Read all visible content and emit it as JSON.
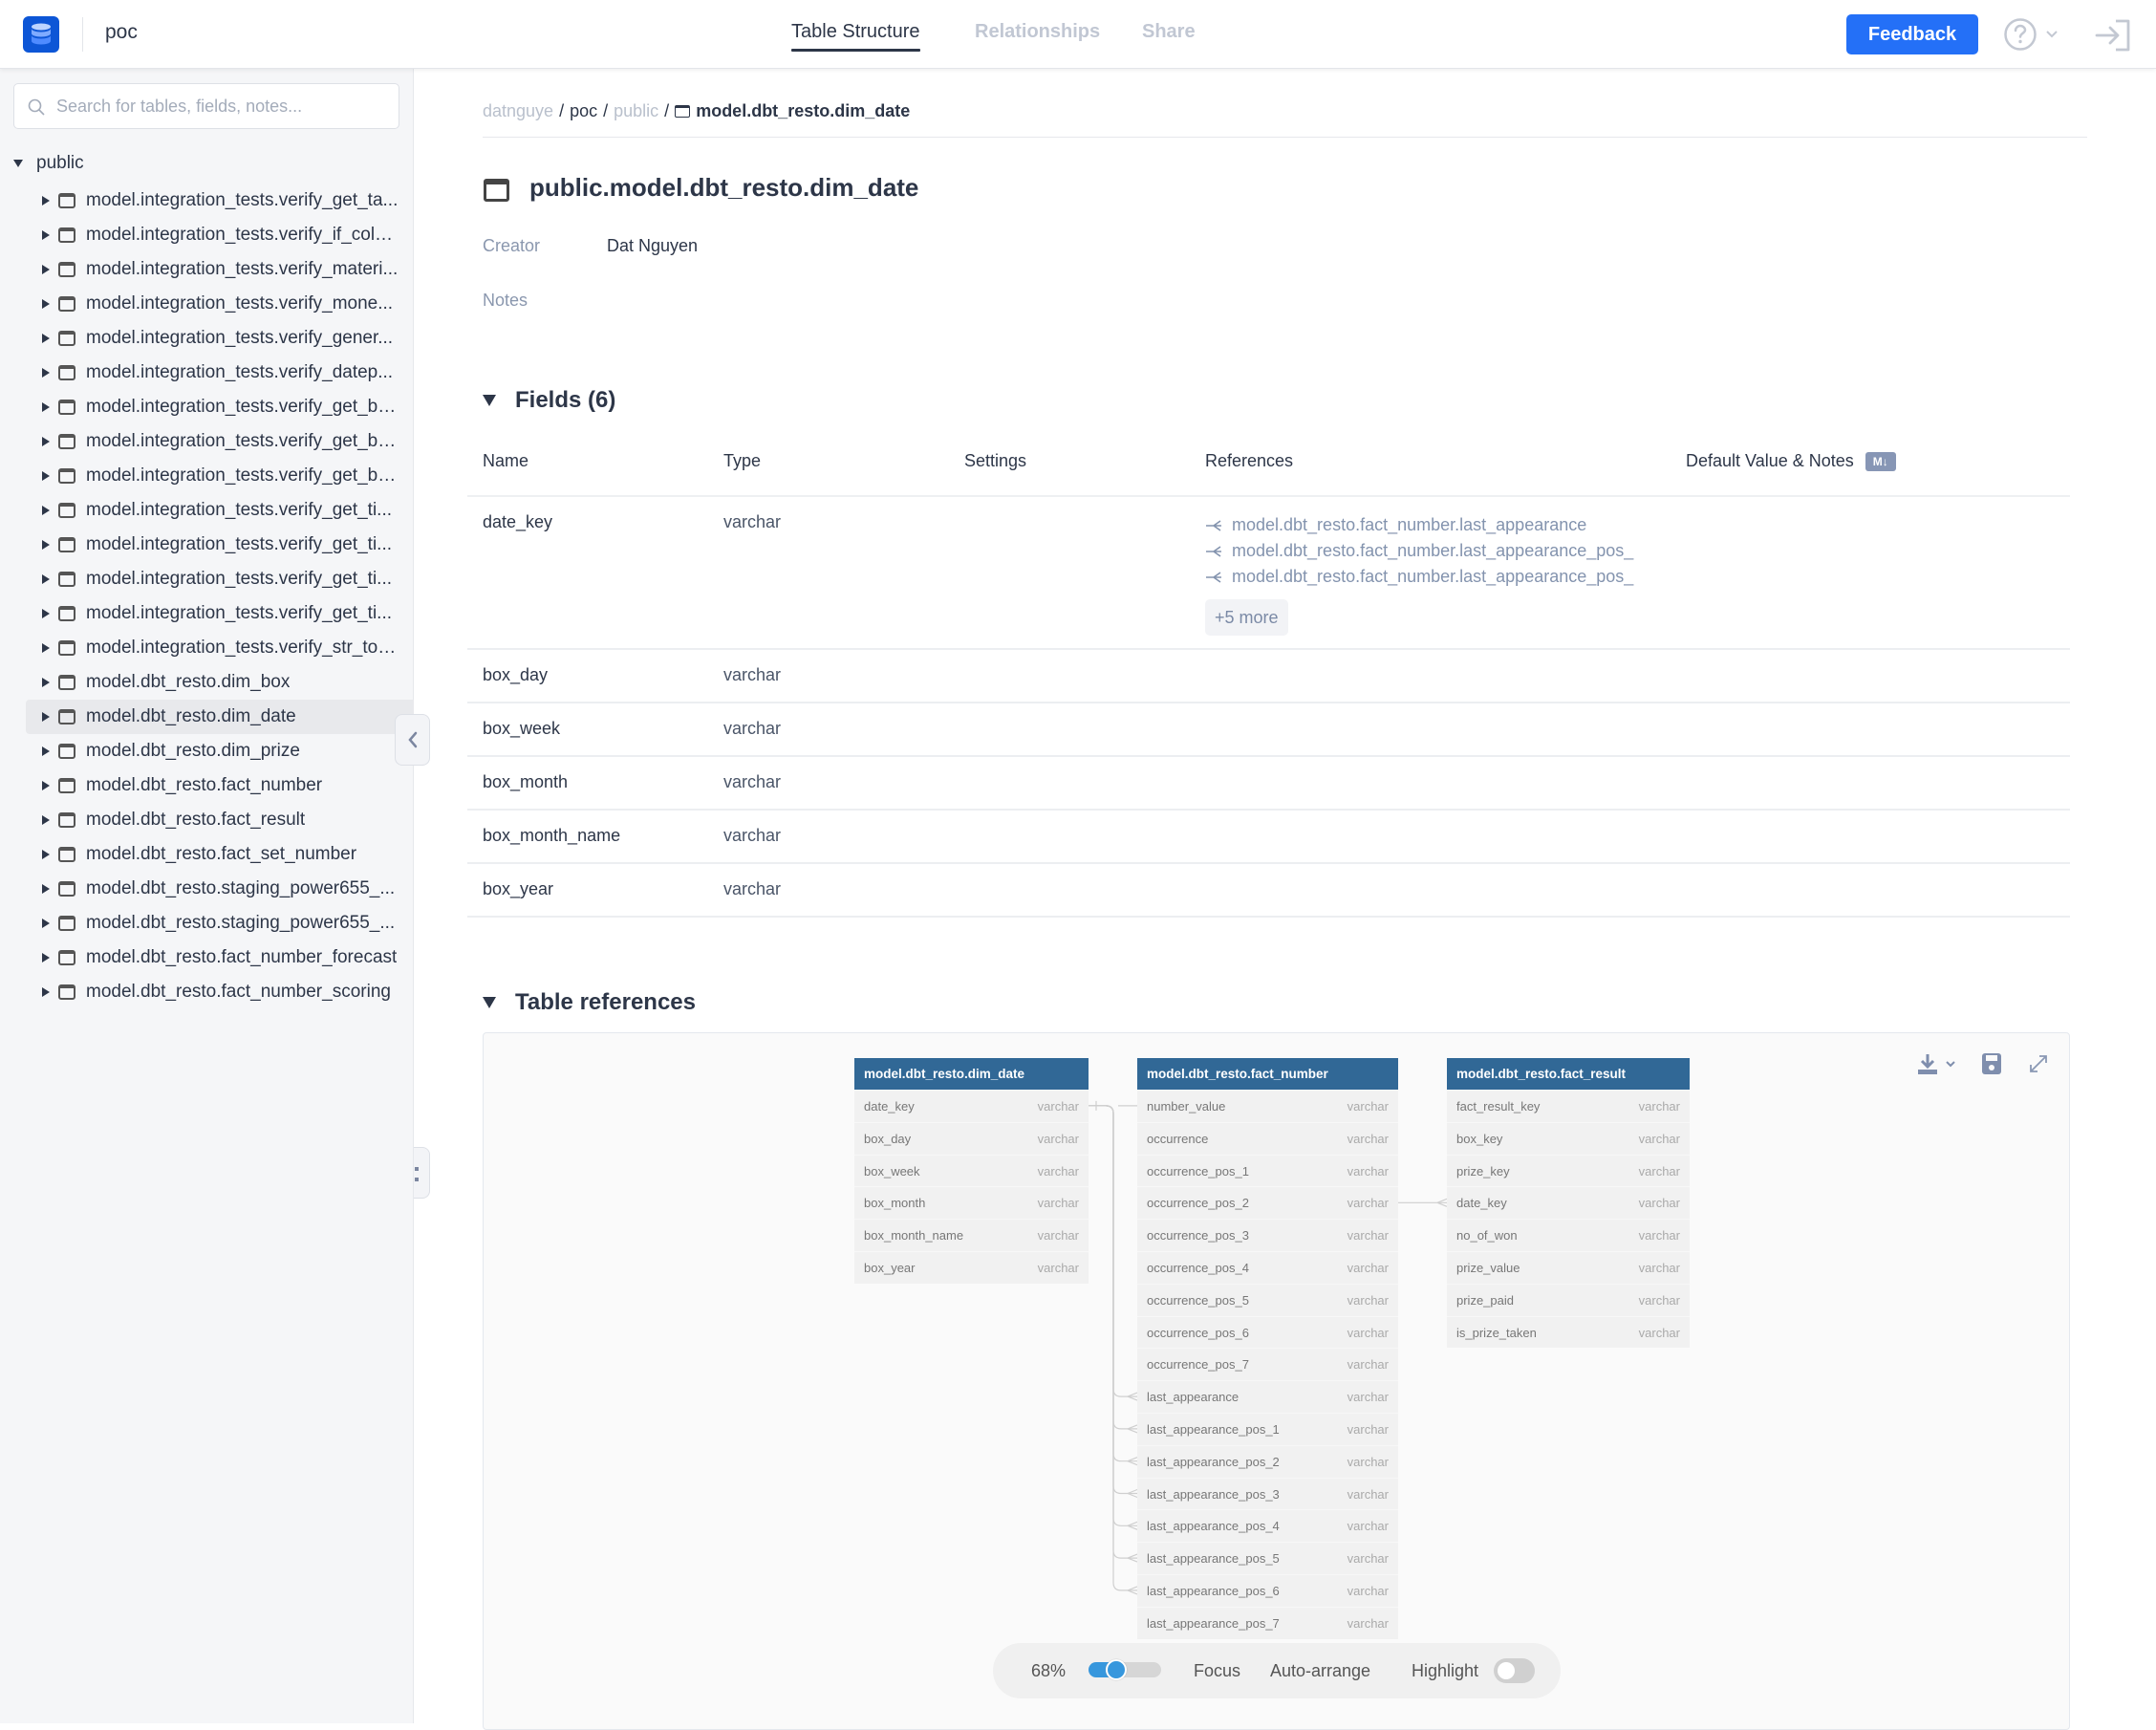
{
  "header": {
    "project_name": "poc",
    "tabs": [
      {
        "label": "Table Structure",
        "active": true
      },
      {
        "label": "Relationships",
        "active": false
      },
      {
        "label": "Share",
        "active": false
      }
    ],
    "feedback_label": "Feedback",
    "accent_color": "#2470f7"
  },
  "sidebar": {
    "search_placeholder": "Search for tables, fields, notes...",
    "search_value": "",
    "schema": "public",
    "selected_index": 15,
    "items": [
      "model.integration_tests.verify_get_ta...",
      "model.integration_tests.verify_if_colu...",
      "model.integration_tests.verify_materi...",
      "model.integration_tests.verify_mone...",
      "model.integration_tests.verify_gener...",
      "model.integration_tests.verify_datep...",
      "model.integration_tests.verify_get_ba...",
      "model.integration_tests.verify_get_ba...",
      "model.integration_tests.verify_get_ba...",
      "model.integration_tests.verify_get_ti...",
      "model.integration_tests.verify_get_ti...",
      "model.integration_tests.verify_get_ti...",
      "model.integration_tests.verify_get_ti...",
      "model.integration_tests.verify_str_to_...",
      "model.dbt_resto.dim_box",
      "model.dbt_resto.dim_date",
      "model.dbt_resto.dim_prize",
      "model.dbt_resto.fact_number",
      "model.dbt_resto.fact_result",
      "model.dbt_resto.fact_set_number",
      "model.dbt_resto.staging_power655_...",
      "model.dbt_resto.staging_power655_...",
      "model.dbt_resto.fact_number_forecast",
      "model.dbt_resto.fact_number_scoring"
    ]
  },
  "breadcrumb": {
    "user": "datnguye",
    "project": "poc",
    "schema": "public",
    "table": "model.dbt_resto.dim_date",
    "separator": "/"
  },
  "table": {
    "title": "public.model.dbt_resto.dim_date",
    "creator_label": "Creator",
    "creator": "Dat Nguyen",
    "notes_label": "Notes",
    "notes": ""
  },
  "fields_section": {
    "title": "Fields (6)",
    "columns": [
      "Name",
      "Type",
      "Settings",
      "References",
      "Default Value & Notes"
    ],
    "md_badge": "M↓",
    "rows": [
      {
        "name": "date_key",
        "type": "varchar",
        "settings": "",
        "references": [
          "model.dbt_resto.fact_number.last_appearance",
          "model.dbt_resto.fact_number.last_appearance_pos_",
          "model.dbt_resto.fact_number.last_appearance_pos_"
        ],
        "more": "+5 more"
      },
      {
        "name": "box_day",
        "type": "varchar",
        "settings": "",
        "references": []
      },
      {
        "name": "box_week",
        "type": "varchar",
        "settings": "",
        "references": []
      },
      {
        "name": "box_month",
        "type": "varchar",
        "settings": "",
        "references": []
      },
      {
        "name": "box_month_name",
        "type": "varchar",
        "settings": "",
        "references": []
      },
      {
        "name": "box_year",
        "type": "varchar",
        "settings": "",
        "references": []
      }
    ]
  },
  "references_section": {
    "title": "Table references",
    "header_color": "#316896",
    "tables": [
      {
        "name": "model.dbt_resto.dim_date",
        "fields": [
          [
            "date_key",
            "varchar"
          ],
          [
            "box_day",
            "varchar"
          ],
          [
            "box_week",
            "varchar"
          ],
          [
            "box_month",
            "varchar"
          ],
          [
            "box_month_name",
            "varchar"
          ],
          [
            "box_year",
            "varchar"
          ]
        ]
      },
      {
        "name": "model.dbt_resto.fact_number",
        "fields": [
          [
            "number_value",
            "varchar"
          ],
          [
            "occurrence",
            "varchar"
          ],
          [
            "occurrence_pos_1",
            "varchar"
          ],
          [
            "occurrence_pos_2",
            "varchar"
          ],
          [
            "occurrence_pos_3",
            "varchar"
          ],
          [
            "occurrence_pos_4",
            "varchar"
          ],
          [
            "occurrence_pos_5",
            "varchar"
          ],
          [
            "occurrence_pos_6",
            "varchar"
          ],
          [
            "occurrence_pos_7",
            "varchar"
          ],
          [
            "last_appearance",
            "varchar"
          ],
          [
            "last_appearance_pos_1",
            "varchar"
          ],
          [
            "last_appearance_pos_2",
            "varchar"
          ],
          [
            "last_appearance_pos_3",
            "varchar"
          ],
          [
            "last_appearance_pos_4",
            "varchar"
          ],
          [
            "last_appearance_pos_5",
            "varchar"
          ],
          [
            "last_appearance_pos_6",
            "varchar"
          ],
          [
            "last_appearance_pos_7",
            "varchar"
          ]
        ]
      },
      {
        "name": "model.dbt_resto.fact_result",
        "fields": [
          [
            "fact_result_key",
            "varchar"
          ],
          [
            "box_key",
            "varchar"
          ],
          [
            "prize_key",
            "varchar"
          ],
          [
            "date_key",
            "varchar"
          ],
          [
            "no_of_won",
            "varchar"
          ],
          [
            "prize_value",
            "varchar"
          ],
          [
            "prize_paid",
            "varchar"
          ],
          [
            "is_prize_taken",
            "varchar"
          ]
        ]
      }
    ],
    "relations": [
      {
        "from": [
          0,
          0
        ],
        "to": [
          1,
          9
        ]
      },
      {
        "from": [
          0,
          0
        ],
        "to": [
          1,
          10
        ]
      },
      {
        "from": [
          0,
          0
        ],
        "to": [
          1,
          11
        ]
      },
      {
        "from": [
          0,
          0
        ],
        "to": [
          1,
          12
        ]
      },
      {
        "from": [
          0,
          0
        ],
        "to": [
          1,
          13
        ]
      },
      {
        "from": [
          0,
          0
        ],
        "to": [
          1,
          14
        ]
      },
      {
        "from": [
          0,
          0
        ],
        "to": [
          1,
          15
        ]
      },
      {
        "from": [
          0,
          0
        ],
        "to": [
          2,
          3
        ]
      }
    ],
    "toolbar": {
      "zoom_label": "68%",
      "zoom_fraction": 0.68,
      "focus_label": "Focus",
      "arrange_label": "Auto-arrange",
      "highlight_label": "Highlight",
      "highlight_on": false
    }
  }
}
